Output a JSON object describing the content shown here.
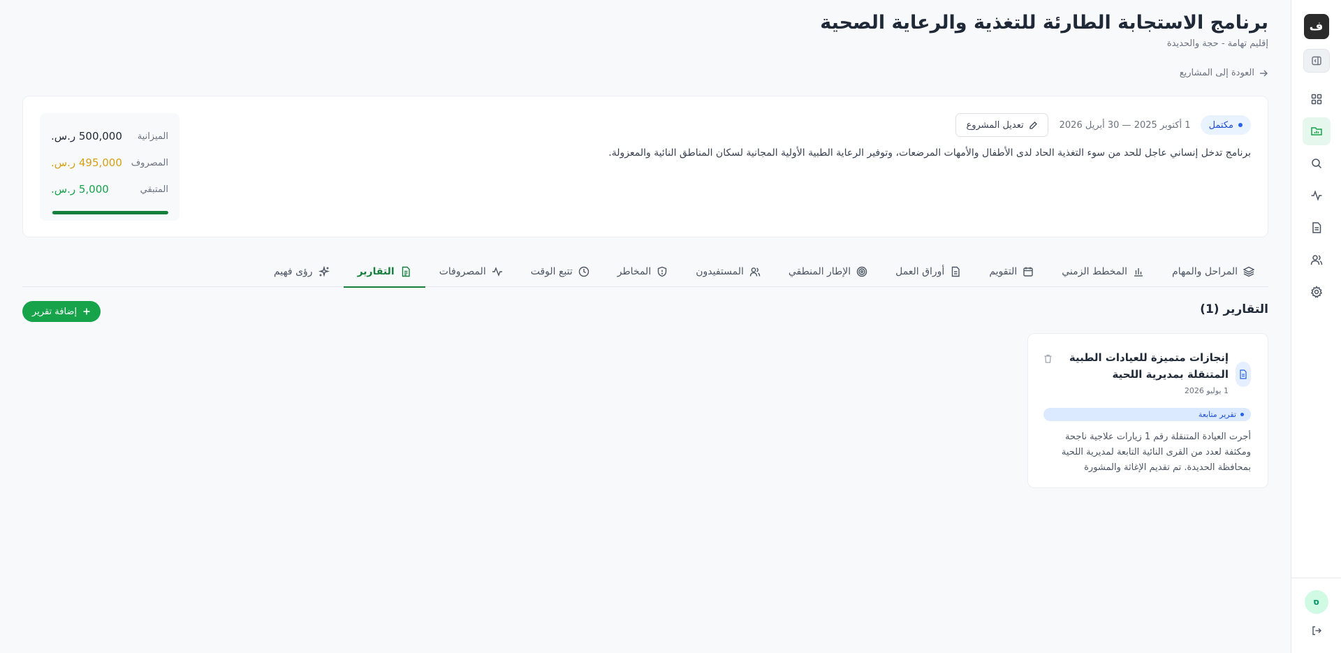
{
  "sidebar": {
    "logo_text": "ف",
    "nav_items": [
      {
        "name": "dashboard",
        "icon": "grid-icon"
      },
      {
        "name": "projects",
        "icon": "folder-chart-icon",
        "active": true
      },
      {
        "name": "search",
        "icon": "search-icon"
      },
      {
        "name": "activity",
        "icon": "activity-icon"
      },
      {
        "name": "documents",
        "icon": "document-icon"
      },
      {
        "name": "users",
        "icon": "users-icon"
      },
      {
        "name": "settings",
        "icon": "gear-icon"
      }
    ],
    "avatar_initial": "ס"
  },
  "header": {
    "title": "برنامج الاستجابة الطارئة للتغذية والرعاية الصحية",
    "subtitle": "إقليم تهامة - حجة والحديدة",
    "back_label": "العودة إلى المشاريع"
  },
  "project": {
    "status": "مكتمل",
    "date_range": "1 أكتوبر 2025 — 30 أبريل 2026",
    "edit_label": "تعديل المشروع",
    "description": "برنامج تدخل إنساني عاجل للحد من سوء التغذية الحاد لدى الأطفال والأمهات المرضعات، وتوفير الرعاية الطبية الأولية المجانية لسكان المناطق النائية والمعزولة.",
    "budget": {
      "budget_label": "الميزانية",
      "budget_value": "500,000 ر.س.",
      "spent_label": "المصروف",
      "spent_value": "495,000 ر.س.",
      "remaining_label": "المتبقي",
      "remaining_value": "5,000 ر.س.",
      "spent_fraction": 0.99
    }
  },
  "tabs": [
    {
      "label": "المراحل والمهام",
      "icon": "layers-icon"
    },
    {
      "label": "المخطط الزمني",
      "icon": "bar-chart-icon"
    },
    {
      "label": "التقويم",
      "icon": "calendar-icon"
    },
    {
      "label": "أوراق العمل",
      "icon": "file-icon"
    },
    {
      "label": "الإطار المنطقي",
      "icon": "target-icon"
    },
    {
      "label": "المستفيدون",
      "icon": "users-icon"
    },
    {
      "label": "المخاطر",
      "icon": "shield-icon"
    },
    {
      "label": "تتبع الوقت",
      "icon": "clock-icon"
    },
    {
      "label": "المصروفات",
      "icon": "activity-icon"
    },
    {
      "label": "التقارير",
      "icon": "report-icon",
      "active": true
    },
    {
      "label": "رؤى فهيم",
      "icon": "sparkles-icon"
    }
  ],
  "reports": {
    "section_title": "التقارير (1)",
    "add_label": "إضافة تقرير",
    "items": [
      {
        "title": "إنجازات متميزة للعيادات الطبية المتنقلة بمديرية اللحية",
        "date": "1 يوليو 2026",
        "type": "تقرير متابعة",
        "body": "أجرت العيادة المتنقلة رقم 1 زيارات علاجية ناجحة ومكثفة لعدد من القرى النائية التابعة لمديرية اللحية بمحافظة الحديدة. تم تقديم الإغاثة والمشورة"
      }
    ]
  },
  "colors": {
    "accent": "#16a34a",
    "status_blue": "#1d4ed8",
    "spent": "#d4a017"
  }
}
